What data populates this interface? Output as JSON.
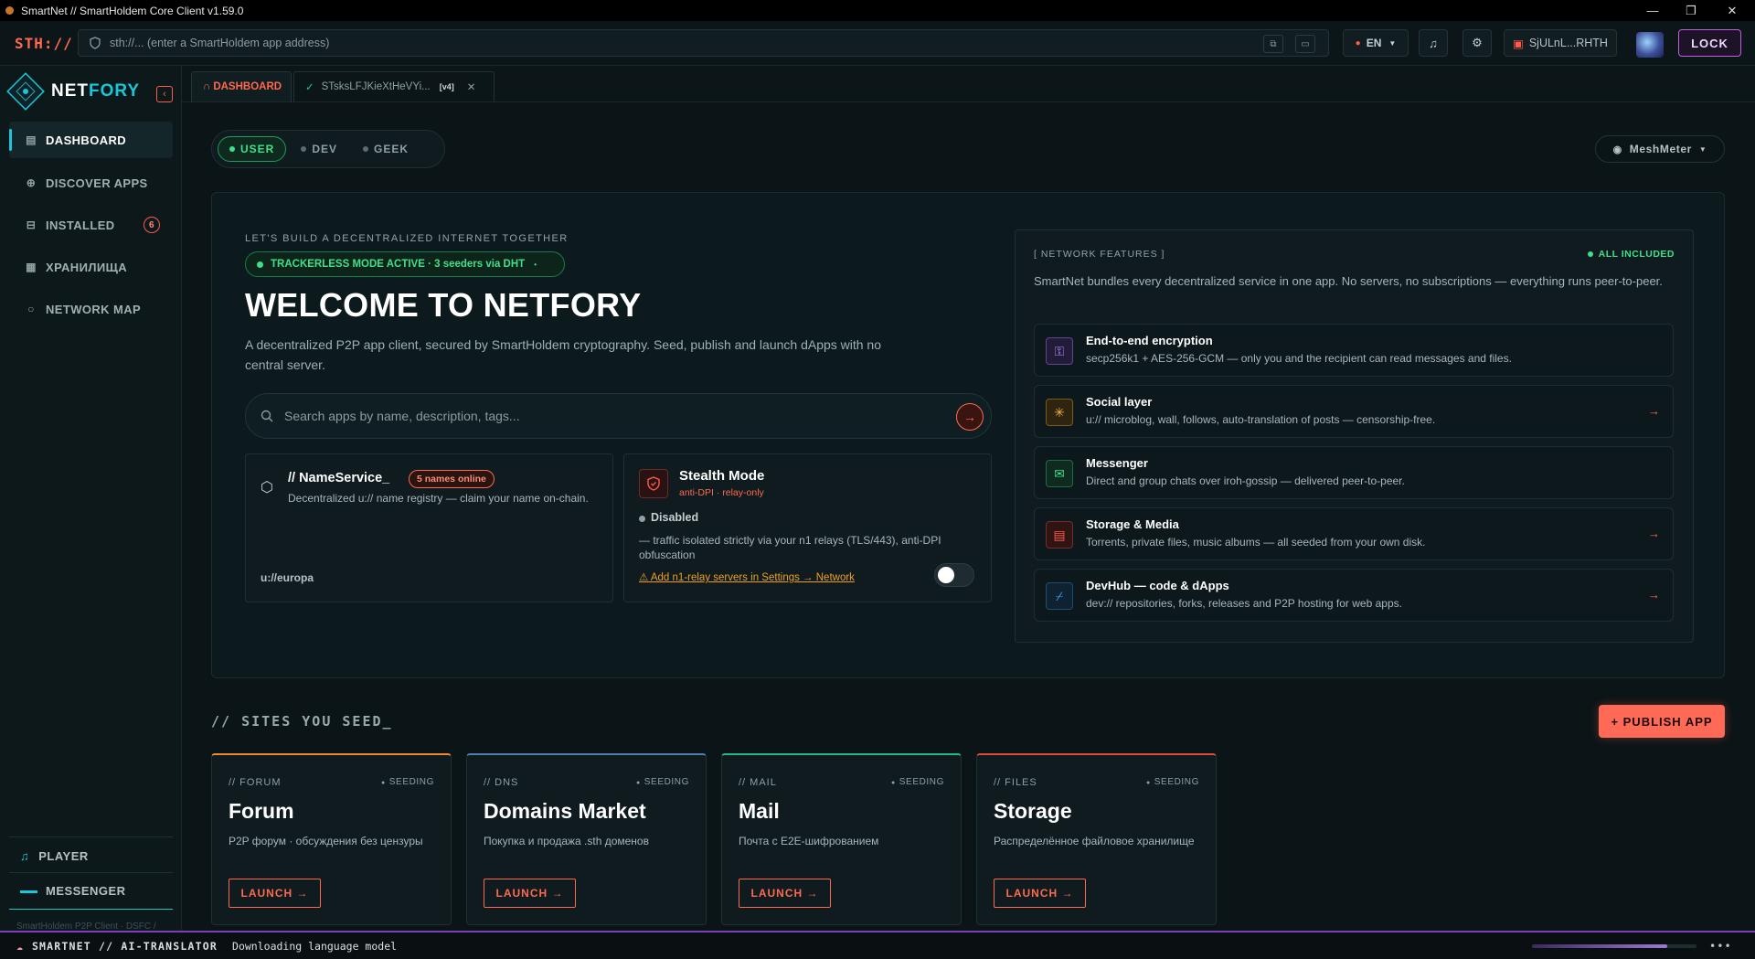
{
  "window": {
    "title": "SmartNet // SmartHoldem Core Client v1.59.0"
  },
  "topbar": {
    "brand": "STH://",
    "address_placeholder": "sth://... (enter a SmartHoldem app address)",
    "lang": "EN",
    "wallet": "SjULnL...RHTH",
    "lock": "LOCK"
  },
  "sidebar": {
    "logo": {
      "part1": "NET",
      "part2": "FORY"
    },
    "items": [
      {
        "label": "DASHBOARD",
        "icon": "dashboard-icon"
      },
      {
        "label": "DISCOVER APPS",
        "icon": "globe-icon"
      },
      {
        "label": "INSTALLED",
        "icon": "box-icon",
        "count": "6"
      },
      {
        "label": "ХРАНИЛИЩА",
        "icon": "storage-icon"
      },
      {
        "label": "NETWORK MAP",
        "icon": "circle-icon"
      }
    ],
    "player": "PLAYER",
    "messenger": "MESSENGER",
    "version": "SmartHoldem P2P Client · DSFC /"
  },
  "tabs": {
    "dashboard": "DASHBOARD",
    "app_tab": "STsksLFJKieXtHeVYi...",
    "app_tab_version": "[v4]"
  },
  "modes": {
    "user": "USER",
    "dev": "DEV",
    "geek": "GEEK",
    "active": "user"
  },
  "meshmeter": "MeshMeter",
  "hero": {
    "tagline": "LET'S BUILD A DECENTRALIZED INTERNET TOGETHER",
    "tracker": "TRACKERLESS MODE ACTIVE · 3 seeders via DHT",
    "title": "WELCOME TO NETFORY",
    "subtitle": "A decentralized P2P app client, secured by SmartHoldem cryptography. Seed, publish and launch dApps with no central server.",
    "search_placeholder": "Search apps by name, description, tags..."
  },
  "nameservice": {
    "title": "// NameService_",
    "badge": "5 names online",
    "desc": "Decentralized u:// name registry — claim your name on-chain.",
    "name": "u://europa"
  },
  "stealth": {
    "title": "Stealth Mode",
    "sub": "anti-DPI · relay-only",
    "status": "Disabled",
    "desc": "— traffic isolated strictly via your n1 relays (TLS/443), anti-DPI obfuscation",
    "warning": "⚠ Add n1-relay servers in Settings → Network",
    "enabled": false
  },
  "features": {
    "header": "[ NETWORK FEATURES ]",
    "badge": "ALL INCLUDED",
    "intro": "SmartNet bundles every decentralized service in one app. No servers, no subscriptions — everything runs peer-to-peer.",
    "items": [
      {
        "title": "End-to-end encryption",
        "desc": "secp256k1 + AES-256-GCM — only you and the recipient can read messages and files.",
        "icon": "key-icon",
        "color": "#b48cf0",
        "arrow": ""
      },
      {
        "title": "Social layer",
        "desc": "u:// microblog, wall, follows, auto-translation of posts — censorship-free.",
        "icon": "sparkle-icon",
        "color": "#f0b43c",
        "arrow": "→"
      },
      {
        "title": "Messenger",
        "desc": "Direct and group chats over iroh-gossip — delivered peer-to-peer.",
        "icon": "mail-icon",
        "color": "#3ee089",
        "arrow": ""
      },
      {
        "title": "Storage & Media",
        "desc": "Torrents, private files, music albums — all seeded from your own disk.",
        "icon": "storage-icon",
        "color": "#ff5a4a",
        "arrow": "→"
      },
      {
        "title": "DevHub — code & dApps",
        "desc": "dev:// repositories, forks, releases and P2P hosting for web apps.",
        "icon": "code-icon",
        "color": "#3aa8f0",
        "arrow": "→"
      }
    ]
  },
  "sites": {
    "title": "// SITES YOU SEED_",
    "publish": "+ PUBLISH APP",
    "items": [
      {
        "cat": "// FORUM",
        "status": "SEEDING",
        "name": "Forum",
        "desc": "P2P форум · обсуждения без цензуры",
        "launch": "LAUNCH →",
        "accent": "#f08a2c"
      },
      {
        "cat": "// DNS",
        "status": "SEEDING",
        "name": "Domains Market",
        "desc": "Покупка и продажа .sth доменов",
        "launch": "LAUNCH →",
        "accent": "#4f7fb0"
      },
      {
        "cat": "// MAIL",
        "status": "SEEDING",
        "name": "Mail",
        "desc": "Почта с E2E-шифрованием",
        "launch": "LAUNCH →",
        "accent": "#22b98a"
      },
      {
        "cat": "// FILES",
        "status": "SEEDING",
        "name": "Storage",
        "desc": "Распределённое файловое хранилище",
        "launch": "LAUNCH →",
        "accent": "#e04a3c"
      }
    ]
  },
  "statusbar": {
    "label": "SMARTNET // AI-TRANSLATOR",
    "text": "Downloading language model",
    "progress": 0.82
  }
}
